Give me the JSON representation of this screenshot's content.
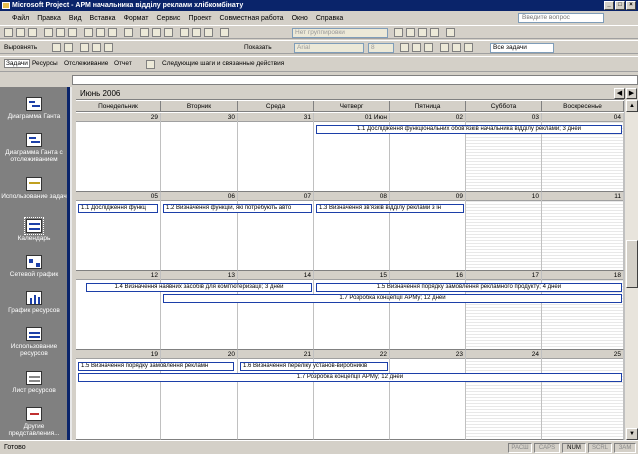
{
  "window": {
    "title": "Microsoft Project - АРМ начальника відділу реклами хлібкомбінату"
  },
  "menu": [
    "Файл",
    "Правка",
    "Вид",
    "Вставка",
    "Формат",
    "Сервис",
    "Проект",
    "Совместная работа",
    "Окно",
    "Справка"
  ],
  "help": {
    "placeholder": "Введите вопрос"
  },
  "toolbar": {
    "group_combo": "Нет группировки",
    "align_label": "Выровнять",
    "show_label": "Показать",
    "font_combo": "Arial",
    "size_combo": "8",
    "filter_combo": "Все задачи"
  },
  "guide": {
    "tabs": [
      "Задачи",
      "Ресурсы",
      "Отслеживание",
      "Отчет"
    ],
    "next_steps": "Следующие шаги и связанные действия"
  },
  "views": [
    {
      "label": "Диаграмма Ганта"
    },
    {
      "label": "Диаграмма Ганта с отслеживанием"
    },
    {
      "label": "Использование задач"
    },
    {
      "label": "Календарь"
    },
    {
      "label": "Сетевой график"
    },
    {
      "label": "График ресурсов"
    },
    {
      "label": "Использование ресурсов"
    },
    {
      "label": "Лист ресурсов"
    },
    {
      "label": "Другие представления..."
    }
  ],
  "calendar": {
    "month": "Июнь 2006",
    "days": [
      "Понедельник",
      "Вторник",
      "Среда",
      "Четверг",
      "Пятница",
      "Суббота",
      "Воскресенье"
    ],
    "weeks": [
      {
        "dates": [
          "29",
          "30",
          "31",
          "01 Июн",
          "02",
          "03",
          "04"
        ]
      },
      {
        "dates": [
          "05",
          "06",
          "07",
          "08",
          "09",
          "10",
          "11"
        ]
      },
      {
        "dates": [
          "12",
          "13",
          "14",
          "15",
          "16",
          "17",
          "18"
        ]
      },
      {
        "dates": [
          "19",
          "20",
          "21",
          "22",
          "23",
          "24",
          "25"
        ]
      }
    ],
    "tasks": {
      "t11": "1.1 Дослідження функціональних обов'язків начальника відділу реклами; 3 дней",
      "t11b": "1.1 Дослідження функц",
      "t12": "1.2 Визначення функцій, які потребують авто",
      "t13": "1.3 Визначення зв'язків відділу реклами з ін",
      "t14": "1.4 Визначення наявних засобів для комп'ютеризації; 3 дней",
      "t15": "1.5 Визначення порядку замовлення рекламного продукту; 4 дней",
      "t17": "1.7 Розробка концепції АРМу; 12 дней",
      "t15b": "1.5 Визначення порядку замовлення рекламн",
      "t16": "1.6 Визначення переліку установ-виробників",
      "t17b": "1.7 Розробка концепції АРМу; 12 дней"
    }
  },
  "status": {
    "ready": "Готово",
    "indicators": [
      "РАСШ",
      "CAPS",
      "NUM",
      "SCRL",
      "ЗАМ"
    ]
  }
}
